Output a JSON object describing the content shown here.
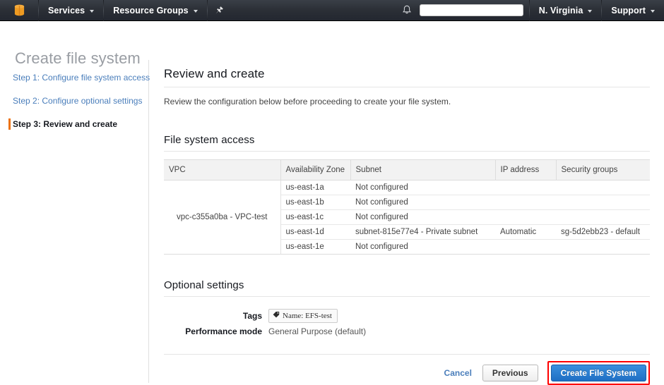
{
  "navbar": {
    "logo_icon": "aws-cube-icon",
    "services_label": "Services",
    "resource_groups_label": "Resource Groups",
    "pin_icon": "pin-icon",
    "bell_icon": "bell-icon",
    "search_value": "",
    "search_placeholder": "",
    "region_label": "N. Virginia",
    "support_label": "Support",
    "accent_orange": "#ec7211"
  },
  "page": {
    "title": "Create file system"
  },
  "sidebar": {
    "steps": [
      {
        "label": "Step 1: Configure file system access",
        "active": false
      },
      {
        "label": "Step 2: Configure optional settings",
        "active": false
      },
      {
        "label": "Step 3: Review and create",
        "active": true
      }
    ]
  },
  "main": {
    "heading": "Review and create",
    "intro": "Review the configuration below before proceeding to create your file system.",
    "file_system_access": {
      "heading": "File system access",
      "columns": [
        "VPC",
        "Availability Zone",
        "Subnet",
        "IP address",
        "Security groups"
      ],
      "vpc": "vpc-c355a0ba - VPC-test",
      "rows": [
        {
          "az": "us-east-1a",
          "subnet": "Not configured",
          "ip": "",
          "sg": ""
        },
        {
          "az": "us-east-1b",
          "subnet": "Not configured",
          "ip": "",
          "sg": ""
        },
        {
          "az": "us-east-1c",
          "subnet": "Not configured",
          "ip": "",
          "sg": ""
        },
        {
          "az": "us-east-1d",
          "subnet": "subnet-815e77e4 - Private subnet",
          "ip": "Automatic",
          "sg": "sg-5d2ebb23 - default"
        },
        {
          "az": "us-east-1e",
          "subnet": "Not configured",
          "ip": "",
          "sg": ""
        }
      ]
    },
    "optional_settings": {
      "heading": "Optional settings",
      "tags_label": "Tags",
      "tag_chip": "Name: EFS-test",
      "tag_icon": "tag-icon",
      "performance_label": "Performance mode",
      "performance_value": "General Purpose (default)"
    }
  },
  "footer": {
    "cancel_label": "Cancel",
    "previous_label": "Previous",
    "create_label": "Create File System",
    "highlight_color": "#ff0000"
  }
}
